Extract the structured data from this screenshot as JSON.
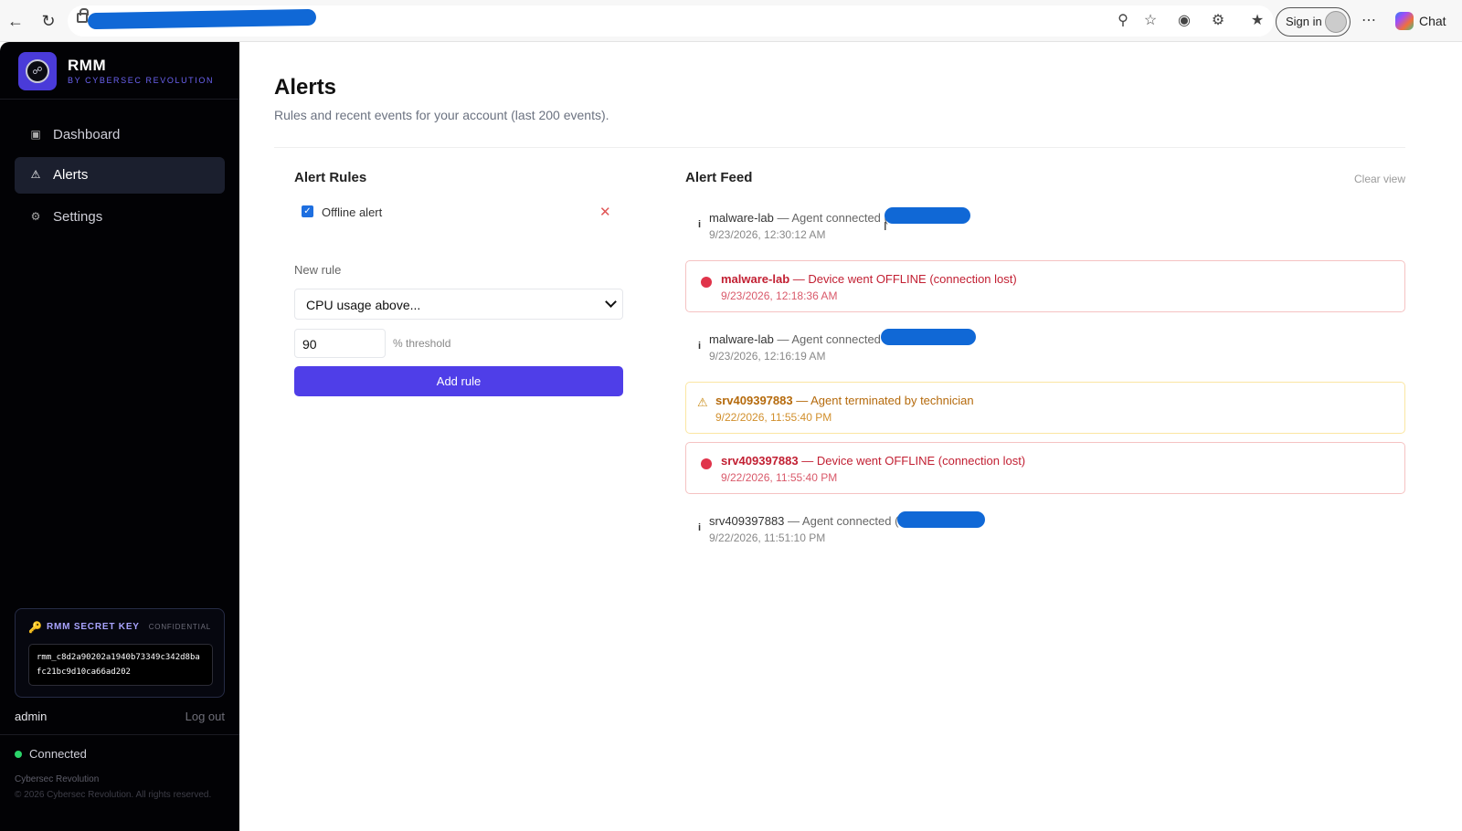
{
  "browser": {
    "signin_label": "Sign in",
    "chat_label": "Chat",
    "icons": [
      "back-icon",
      "refresh-icon",
      "key-icon",
      "star-icon",
      "extension-icon",
      "puzzle-icon",
      "favorites-icon",
      "more-icon"
    ]
  },
  "sidebar": {
    "brand": "RMM",
    "brand_sub": "BY CYBERSEC REVOLUTION",
    "nav": [
      {
        "label": "Dashboard",
        "icon": "dashboard-icon",
        "active": false
      },
      {
        "label": "Alerts",
        "icon": "alert-triangle-icon",
        "active": true
      },
      {
        "label": "Settings",
        "icon": "gear-icon",
        "active": false
      }
    ],
    "secret_key": {
      "title": "RMM SECRET KEY",
      "badge": "CONFIDENTIAL",
      "value": "rmm_c8d2a90202a1940b73349c342d8bafc21bc9d10ca66ad202"
    },
    "user": "admin",
    "logout_label": "Log out",
    "connection_status": "Connected",
    "footer_name": "Cybersec Revolution",
    "footer_copyright": "© 2026 Cybersec Revolution. All rights reserved."
  },
  "main": {
    "title": "Alerts",
    "subtitle": "Rules and recent events for your account (last 200 events).",
    "rules": {
      "title": "Alert Rules",
      "items": [
        {
          "label": "Offline alert",
          "enabled": true
        }
      ],
      "new_rule_label": "New rule",
      "rule_type_selected": "CPU usage above...",
      "threshold_value": "90",
      "threshold_label": "% threshold",
      "add_button": "Add rule"
    },
    "feed": {
      "title": "Alert Feed",
      "clear_label": "Clear view",
      "items": [
        {
          "severity": "info",
          "device": "malware-lab",
          "message": "— Agent connected (",
          "time": "9/23/2026, 12:30:12 AM"
        },
        {
          "severity": "error",
          "device": "malware-lab",
          "message": "— Device went OFFLINE (connection lost)",
          "time": "9/23/2026, 12:18:36 AM"
        },
        {
          "severity": "info",
          "device": "malware-lab",
          "message": "— Agent connected",
          "time": "9/23/2026, 12:16:19 AM"
        },
        {
          "severity": "warning",
          "device": "srv409397883",
          "message": "— Agent terminated by technician",
          "time": "9/22/2026, 11:55:40 PM"
        },
        {
          "severity": "error",
          "device": "srv409397883",
          "message": "— Device went OFFLINE (connection lost)",
          "time": "9/22/2026, 11:55:40 PM"
        },
        {
          "severity": "info",
          "device": "srv409397883",
          "message": "— Agent connected (",
          "time": "9/22/2026, 11:51:10 PM"
        }
      ]
    }
  },
  "colors": {
    "accent": "#4f3ee8",
    "sidebar_bg": "#020205",
    "error": "#c22033",
    "warning": "#b56a0c",
    "connected": "#2bd46a"
  }
}
